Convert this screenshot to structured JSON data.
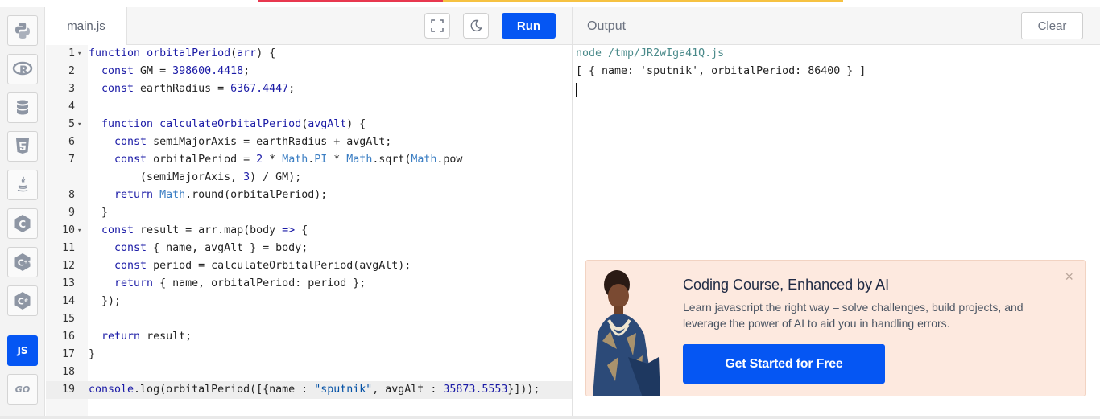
{
  "editor": {
    "file_tab": "main.js",
    "run_label": "Run",
    "lines": [
      {
        "n": "1",
        "fold": true,
        "html": "<span class=\"kw\">function</span> <span class=\"fn\">orbitalPeriod</span>(<span class=\"fn\">arr</span>) {"
      },
      {
        "n": "2",
        "fold": false,
        "html": "  <span class=\"kw\">const</span> GM = <span class=\"num\">398600.4418</span>;"
      },
      {
        "n": "3",
        "fold": false,
        "html": "  <span class=\"kw\">const</span> earthRadius = <span class=\"num\">6367.4447</span>;"
      },
      {
        "n": "4",
        "fold": false,
        "html": ""
      },
      {
        "n": "5",
        "fold": true,
        "html": "  <span class=\"kw\">function</span> <span class=\"fn\">calculateOrbitalPeriod</span>(<span class=\"fn\">avgAlt</span>) {"
      },
      {
        "n": "6",
        "fold": false,
        "html": "    <span class=\"kw\">const</span> semiMajorAxis = earthRadius + avgAlt;"
      },
      {
        "n": "7",
        "fold": false,
        "html": "    <span class=\"kw\">const</span> orbitalPeriod = <span class=\"num\">2</span> * <span class=\"obj\">Math</span>.<span class=\"obj\">PI</span> * <span class=\"obj\">Math</span>.sqrt(<span class=\"obj\">Math</span>.pow"
      },
      {
        "n": "",
        "fold": false,
        "html": "        (semiMajorAxis, <span class=\"num\">3</span>) / GM);"
      },
      {
        "n": "8",
        "fold": false,
        "html": "    <span class=\"kw\">return</span> <span class=\"obj\">Math</span>.round(orbitalPeriod);"
      },
      {
        "n": "9",
        "fold": false,
        "html": "  }"
      },
      {
        "n": "10",
        "fold": true,
        "html": "  <span class=\"kw\">const</span> result = arr.map(body <span class=\"kw\">=&gt;</span> {"
      },
      {
        "n": "11",
        "fold": false,
        "html": "    <span class=\"kw\">const</span> { name, avgAlt } = body;"
      },
      {
        "n": "12",
        "fold": false,
        "html": "    <span class=\"kw\">const</span> period = calculateOrbitalPeriod(avgAlt);"
      },
      {
        "n": "13",
        "fold": false,
        "html": "    <span class=\"kw\">return</span> { name, orbitalPeriod: period };"
      },
      {
        "n": "14",
        "fold": false,
        "html": "  });"
      },
      {
        "n": "15",
        "fold": false,
        "html": ""
      },
      {
        "n": "16",
        "fold": false,
        "html": "  <span class=\"kw\">return</span> result;"
      },
      {
        "n": "17",
        "fold": false,
        "html": "}"
      },
      {
        "n": "18",
        "fold": false,
        "html": ""
      },
      {
        "n": "19",
        "fold": false,
        "current": true,
        "html": "<span class=\"kw\">console</span>.log(orbitalPeriod([{name : <span class=\"str\">\"sputnik\"</span>, avgAlt : <span class=\"num\">35873.5553</span>}]));"
      }
    ]
  },
  "output": {
    "title": "Output",
    "clear_label": "Clear",
    "command": "node /tmp/JR2wIga41Q.js",
    "result": "[ { name: 'sputnik', orbitalPeriod: 86400 } ]"
  },
  "ad": {
    "headline": "Coding Course, Enhanced by AI",
    "description": "Learn javascript the right way – solve challenges, build projects, and leverage the power of AI to aid you in handling errors.",
    "cta": "Get Started for Free",
    "close_glyph": "×"
  },
  "sidebar": {
    "languages": [
      {
        "name": "python",
        "icon": "python-icon"
      },
      {
        "name": "r",
        "icon": "r-icon"
      },
      {
        "name": "sql",
        "icon": "database-icon"
      },
      {
        "name": "html",
        "icon": "html5-icon"
      },
      {
        "name": "java",
        "icon": "java-icon"
      },
      {
        "name": "c",
        "icon": "c-icon"
      },
      {
        "name": "cpp",
        "icon": "cpp-icon"
      },
      {
        "name": "csharp",
        "icon": "csharp-icon"
      },
      {
        "name": "javascript",
        "icon": "js-icon",
        "label": "JS",
        "active": true
      },
      {
        "name": "go",
        "icon": "go-icon",
        "label": "GO"
      }
    ]
  },
  "colors": {
    "accent": "#0556f3",
    "ad_background": "#fde9df"
  }
}
